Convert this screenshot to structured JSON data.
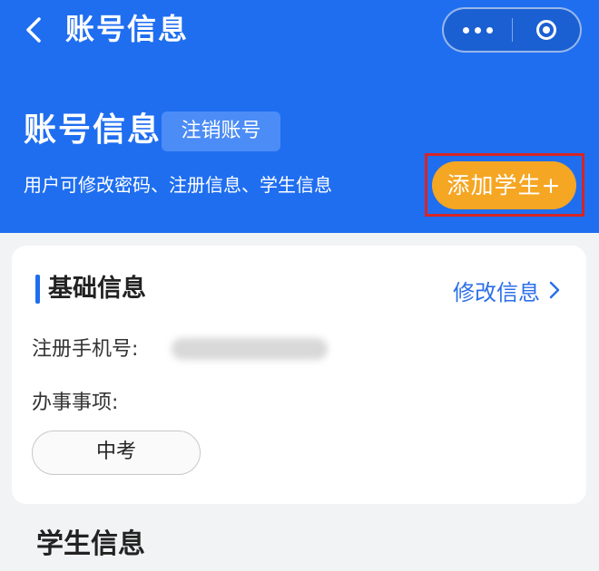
{
  "nav": {
    "title": "账号信息"
  },
  "header": {
    "title": "账号信息",
    "cancel_account_label": "注销账号",
    "subtitle": "用户可修改密码、注册信息、学生信息",
    "add_student_label": "添加学生+"
  },
  "basic_info": {
    "title": "基础信息",
    "edit_label": "修改信息",
    "phone_label": "注册手机号:",
    "matters_label": "办事事项:",
    "matter_value": "中考"
  },
  "student_info": {
    "title": "学生信息"
  },
  "icons": {
    "back": "chevron-left-icon",
    "more": "more-dots-icon",
    "close": "target-circle-icon",
    "edit_arrow": "chevron-right-icon"
  },
  "colors": {
    "header_bg": "#1f6ef0",
    "accent_orange": "#f5a623",
    "highlight_red": "#d62525",
    "link_blue": "#2b6fe8"
  }
}
